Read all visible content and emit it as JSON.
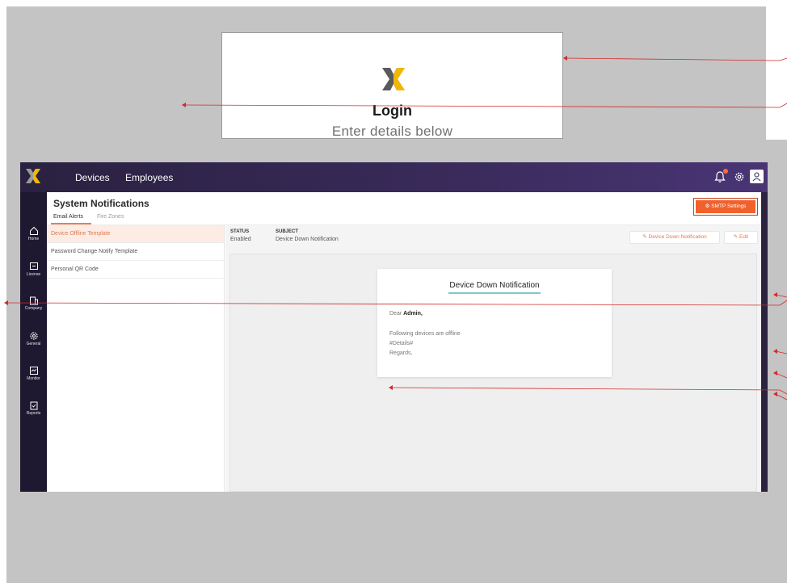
{
  "login": {
    "title": "Login",
    "subtitle": "Enter details below"
  },
  "topbar": {
    "nav": [
      "Devices",
      "Employees"
    ]
  },
  "sidebar": {
    "items": [
      {
        "label": "Home",
        "icon": "home-icon"
      },
      {
        "label": "License",
        "icon": "license-icon"
      },
      {
        "label": "Company",
        "icon": "company-icon"
      },
      {
        "label": "General",
        "icon": "gear-icon"
      },
      {
        "label": "Monitor",
        "icon": "monitor-icon"
      },
      {
        "label": "Reports",
        "icon": "reports-icon"
      }
    ]
  },
  "page": {
    "title": "System Notifications",
    "tabs": [
      "Email Alerts",
      "Fire Zones"
    ],
    "smtp_button": "SMTP Settings"
  },
  "templates": [
    "Device Offline Template",
    "Password Change Notify Template",
    "Personal QR Code"
  ],
  "detail": {
    "status_header": "STATUS",
    "status_value": "Enabled",
    "subject_header": "SUBJECT",
    "subject_value": "Device Down Notification",
    "action_primary": "Device Down Notification",
    "action_edit": "Edit"
  },
  "email": {
    "title": "Device Down Notification",
    "greeting_prefix": "Dear ",
    "greeting_name": "Admin,",
    "line1": "Following devices are offline",
    "line2": "#Details#",
    "line3": "Regards,"
  },
  "colors": {
    "accent": "#f0612c",
    "annotation": "#d22a2a",
    "topbar": "#3a2b5c"
  }
}
